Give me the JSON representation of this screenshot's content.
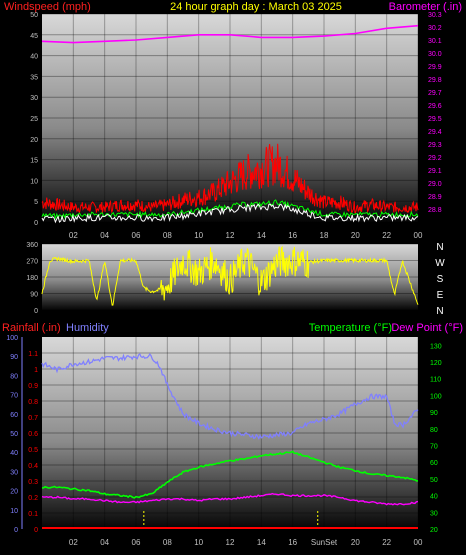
{
  "colors": {
    "background": "#000000",
    "wind_speed": "#ff0000",
    "wind_gust_alt": "#00ff00",
    "wind_avg": "#ffffff",
    "barometer": "#ff00ff",
    "direction": "#ffff00",
    "humidity": "#8080ff",
    "temperature": "#00ff00",
    "dew_point": "#ff00ff",
    "rainfall": "#ff0000",
    "title": "#ffff00",
    "axis_text": "#c0c0c0"
  },
  "chart_data": [
    {
      "type": "line",
      "title": "24 hour graph day : March 03 2025",
      "x_tick_labels": [
        "02",
        "04",
        "06",
        "08",
        "10",
        "12",
        "14",
        "16",
        "18",
        "20",
        "22",
        "00"
      ],
      "x_range_hours": [
        0,
        24
      ],
      "left_axis": {
        "label": "Windspeed (mph)",
        "ylim": [
          0,
          50
        ],
        "ticks": [
          0,
          5,
          10,
          15,
          20,
          25,
          30,
          35,
          40,
          45,
          50
        ]
      },
      "right_axis": {
        "label": "Barometer (.in)",
        "ylim": [
          28.7,
          30.3
        ],
        "ticks": [
          28.8,
          28.9,
          29.0,
          29.1,
          29.2,
          29.3,
          29.4,
          29.5,
          29.6,
          29.7,
          29.8,
          29.9,
          30.0,
          30.1,
          30.2,
          30.3
        ]
      },
      "series": [
        {
          "name": "Windspeed",
          "axis": "left",
          "x": [
            0,
            1,
            2,
            3,
            4,
            5,
            6,
            7,
            8,
            9,
            10,
            11,
            12,
            13,
            14,
            15,
            16,
            17,
            18,
            19,
            20,
            21,
            22,
            23,
            24
          ],
          "y": [
            4,
            3.5,
            3,
            3,
            3,
            3.5,
            3.5,
            3,
            3.5,
            4.5,
            5,
            6,
            8,
            10,
            11,
            12,
            9,
            6,
            4,
            4,
            3,
            3.5,
            3,
            3,
            3
          ]
        },
        {
          "axis": "left",
          "x": [
            0,
            1,
            2,
            3,
            4,
            5,
            6,
            7,
            8,
            9,
            10,
            11,
            12,
            13,
            14,
            15,
            16,
            17,
            18,
            19,
            20,
            21,
            22,
            23,
            24
          ],
          "y": [
            1,
            0.5,
            1,
            1,
            1,
            1,
            1,
            1,
            1,
            1.5,
            2,
            2.5,
            3,
            3.5,
            3.5,
            4,
            3,
            2,
            1,
            1,
            1,
            1,
            1,
            1,
            1
          ]
        },
        {
          "name": "Barometer",
          "axis": "right",
          "x": [
            0,
            2,
            4,
            6,
            8,
            10,
            12,
            14,
            16,
            18,
            20,
            22,
            24
          ],
          "y": [
            30.09,
            30.08,
            30.09,
            30.1,
            30.12,
            30.14,
            30.14,
            30.12,
            30.12,
            30.13,
            30.15,
            30.19,
            30.21
          ]
        }
      ]
    },
    {
      "type": "line",
      "x_range_hours": [
        0,
        24
      ],
      "left_axis": {
        "ylim": [
          0,
          360
        ],
        "ticks": [
          0,
          45,
          90,
          135,
          180,
          225,
          270,
          315,
          360
        ]
      },
      "compass_labels": [
        "N",
        "W",
        "S",
        "E",
        "N"
      ],
      "series": [
        {
          "axis": "left",
          "x": [
            0,
            0.5,
            1,
            2,
            3,
            3.5,
            4,
            4.5,
            5,
            6,
            6.5,
            7,
            7.5,
            8,
            9,
            10,
            11,
            12,
            13,
            14,
            15,
            16,
            17,
            18,
            19,
            20,
            21,
            22,
            22.5,
            23,
            24
          ],
          "y": [
            90,
            270,
            280,
            265,
            270,
            50,
            270,
            20,
            270,
            270,
            120,
            100,
            110,
            130,
            270,
            200,
            270,
            160,
            280,
            150,
            260,
            270,
            260,
            270,
            270,
            270,
            270,
            270,
            80,
            270,
            30
          ]
        }
      ]
    },
    {
      "type": "line",
      "x_tick_labels": [
        "02",
        "04",
        "06",
        "08",
        "10",
        "12",
        "14",
        "16",
        "18",
        "20",
        "22",
        "00"
      ],
      "x_markers": [
        "Sunrise",
        "Sunset"
      ],
      "x_marker_text": "SunSet",
      "left_axis": {
        "label": "Rainfall (.in)",
        "ylim": [
          0,
          1.2
        ],
        "ticks": [
          0,
          0.1,
          0.2,
          0.3,
          0.4,
          0.5,
          0.6,
          0.7,
          0.8,
          0.9,
          1,
          1.1
        ]
      },
      "humidity_axis": {
        "label": "Humidity",
        "ylim": [
          0,
          100
        ],
        "ticks": [
          0,
          10,
          20,
          30,
          40,
          50,
          60,
          70,
          80,
          90,
          100
        ]
      },
      "right_axis": {
        "label": "Temperature (°F)",
        "label2": "Dew Point (°F)",
        "ylim": [
          20,
          135
        ],
        "ticks": [
          20,
          30,
          40,
          50,
          60,
          70,
          80,
          90,
          100,
          110,
          120,
          130
        ]
      },
      "series": [
        {
          "name": "Humidity",
          "axis": "humidity",
          "x": [
            0,
            1,
            2,
            3,
            4,
            5,
            6,
            7,
            7.5,
            8,
            9,
            10,
            11,
            12,
            13,
            14,
            15,
            16,
            17,
            18,
            19,
            20,
            21,
            22,
            22.5,
            23,
            24
          ],
          "y": [
            86,
            83,
            86,
            87,
            89,
            89,
            90,
            90,
            85,
            75,
            60,
            55,
            52,
            50,
            49,
            48,
            49,
            50,
            55,
            57,
            60,
            65,
            69,
            69,
            55,
            54,
            62
          ]
        },
        {
          "name": "Temperature",
          "axis": "right",
          "x": [
            0,
            1,
            2,
            3,
            4,
            5,
            6,
            7,
            8,
            9,
            10,
            11,
            12,
            13,
            14,
            15,
            16,
            17,
            18,
            19,
            20,
            21,
            22,
            23,
            24
          ],
          "y": [
            45,
            45,
            44,
            43,
            41,
            40,
            39,
            41,
            48,
            54,
            57,
            59,
            61,
            62,
            64,
            65,
            66,
            63,
            60,
            57,
            55,
            53,
            52,
            51,
            49
          ]
        },
        {
          "name": "Dew Point",
          "axis": "right",
          "x": [
            0,
            1,
            2,
            3,
            4,
            5,
            6,
            7,
            8,
            9,
            10,
            11,
            12,
            13,
            14,
            15,
            16,
            17,
            18,
            19,
            20,
            21,
            22,
            23,
            24
          ],
          "y": [
            39,
            39,
            38,
            38,
            37,
            36,
            36,
            37,
            38,
            38,
            37,
            38,
            38,
            39,
            40,
            41,
            40,
            40,
            40,
            39,
            37,
            36,
            35,
            35,
            36
          ]
        },
        {
          "name": "Rainfall",
          "axis": "left",
          "x": [
            0,
            24
          ],
          "y": [
            0,
            0
          ]
        }
      ]
    }
  ]
}
